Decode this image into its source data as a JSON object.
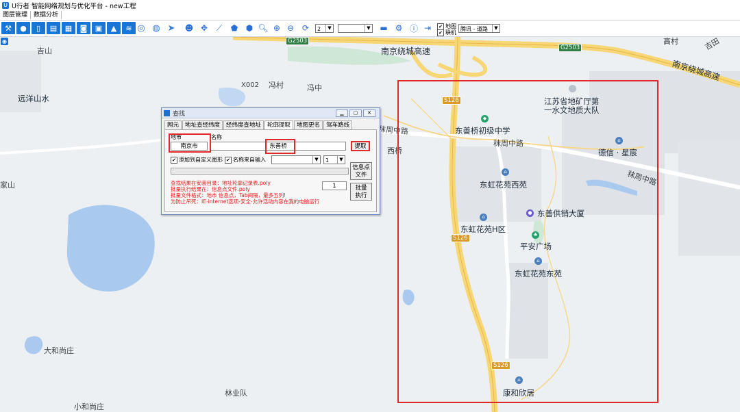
{
  "window": {
    "title": "U行者 智能网络规划与优化平台 - new工程"
  },
  "menu": [
    "图层管理",
    "数据分析"
  ],
  "toolbar": {
    "zoom_level": "2",
    "scale_value": "",
    "map_checkbox": "地图",
    "online_checkbox": "联机",
    "map_source": "腾讯 - 道路"
  },
  "map": {
    "labels": {
      "nanjing_ring_left": "南京绕城高速",
      "nanjing_ring_right": "南京绕城高速",
      "g2503_a": "G2503",
      "g2503_b": "G2503",
      "s126_a": "S126",
      "s126_b": "S126",
      "s126_c": "S126",
      "jishan": "吉山",
      "yuanyang": "远洋山水",
      "x002": "X002",
      "fengcun": "冯村",
      "fengzhong": "冯中",
      "jiangsu": "江苏省地矿厅第",
      "jiangsu2": "一水文地质大队",
      "dongshanqiao": "东善桥初级中学",
      "mozhouzhonglu": "秣周中路",
      "mozhouzhonglu2": "秣周中路",
      "mozhouzhonglu3": "秣周中路",
      "dexin": "德信 · 星宸",
      "donghongxi": "东虹花苑西苑",
      "dongshangongxiao": "东善供销大厦",
      "donghongh": "东虹花苑H区",
      "pingan": "平安广场",
      "donghongdong": "东虹花苑东苑",
      "kanghe": "康和欣居",
      "dahe": "大和尚庄",
      "xiaohe": "小和尚庄",
      "linye": "林业队",
      "jiashan": "家山",
      "xiqiao": "西桥",
      "gaocun": "高村",
      "jitian": "吉田"
    }
  },
  "dialog": {
    "title": "查找",
    "tabs": [
      "网元",
      "地址查经纬度",
      "经纬度查地址",
      "轮廓提取",
      "地图更名",
      "驾车路线"
    ],
    "city_label": "地市",
    "city_value": "南京市",
    "name_label": "名称",
    "name_value": "东善桥",
    "extract_button": "提取",
    "add_custom_check": "添加到自定义图形",
    "name_from_input_check": "名称来自输入",
    "dropdown_value": "",
    "dropdown2_value": "1",
    "info_file_button_l1": "信息点",
    "info_file_button_l2": "文件",
    "batch_count": "1",
    "batch_button_l1": "批量",
    "batch_button_l2": "执行",
    "notes": [
      "查找结果在安装目录：地址轮廓记录表.poly",
      "批量执行结果在：信息点文件.poly",
      "批量文件格式：地市 信息点，Tab间隔，最多五列!",
      "为防止吊死：IE-internet选项-安全-允许活动内容在我的电脑运行"
    ]
  }
}
